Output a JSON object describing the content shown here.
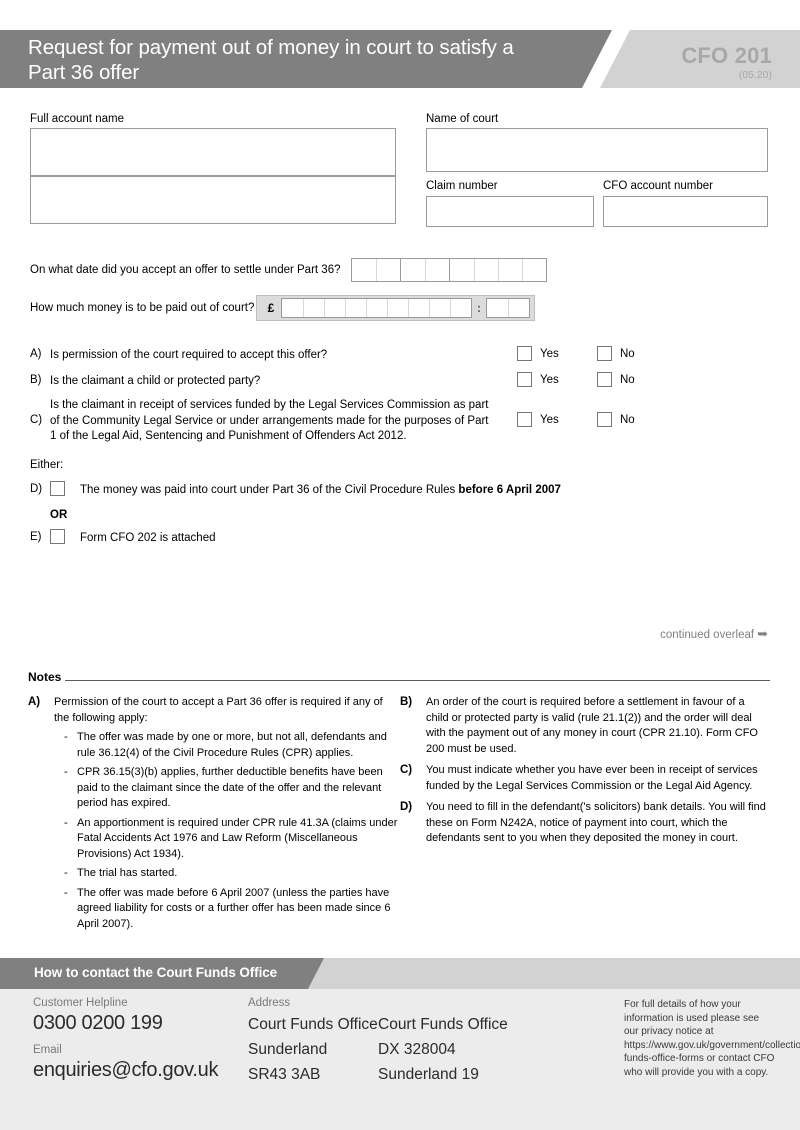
{
  "header": {
    "title": "Request for payment out of money in court to satisfy a Part 36 offer",
    "form_code": "CFO 201",
    "version": "(05.20)"
  },
  "fields": {
    "full_account_name_label": "Full account name",
    "name_of_court_label": "Name of court",
    "claim_number_label": "Claim number",
    "cfo_account_number_label": "CFO account number",
    "full_account_name_value": "",
    "full_account_name_value2": "",
    "name_of_court_value": "",
    "claim_number_value": "",
    "cfo_account_number_value": ""
  },
  "questions": {
    "date_label": "On what date did you accept an offer to settle under Part 36?",
    "money_label": "How much money is to be paid out of court?",
    "currency_symbol": "£",
    "decimal_separator": ":",
    "date_cells": [
      2,
      2,
      4
    ],
    "money_cells": 9,
    "pence_cells": 2,
    "yes_label": "Yes",
    "no_label": "No",
    "items": [
      {
        "letter": "A)",
        "text": "Is permission of the court required to accept this offer?"
      },
      {
        "letter": "B)",
        "text": "Is the claimant a child or protected party?"
      },
      {
        "letter": "C)",
        "text": "Is the claimant in receipt of services funded by the Legal Services Commission as part of the Community Legal Service or under arrangements made for the purposes of Part 1 of the Legal Aid, Sentencing and Punishment of Offenders Act 2012."
      }
    ]
  },
  "either": {
    "either_label": "Either:",
    "or_label": "OR",
    "option_d_letter": "D)",
    "option_d_text": "The money was paid into court under Part 36 of the Civil Procedure Rules ",
    "option_d_bold": "before 6 April 2007",
    "option_e_letter": "E)",
    "option_e_text": "Form CFO 202 is attached"
  },
  "continued": {
    "text": "continued overleaf",
    "arrow": "➥"
  },
  "notes": {
    "title": "Notes",
    "left": [
      {
        "letter": "A)",
        "body": "Permission of the court to accept a Part 36 offer is required if any of the following apply:",
        "subitems": [
          "The offer was made by one or more, but not all, defendants and rule 36.12(4) of the Civil Procedure Rules (CPR) applies.",
          "CPR 36.15(3)(b) applies, further deductible benefits have been paid to the claimant since the date of the offer and the relevant period has expired.",
          "An apportionment is required under CPR rule 41.3A (claims under Fatal Accidents Act 1976 and Law Reform (Miscellaneous Provisions) Act 1934).",
          "The trial has started.",
          "The offer was made before 6 April 2007 (unless the parties have agreed liability for costs or a further offer has been made since 6 April 2007)."
        ]
      }
    ],
    "right": [
      {
        "letter": "B)",
        "body": "An order of the court is required before a settlement in favour of a child or protected party is valid (rule 21.1(2)) and the order will deal with the payment out of any money in court (CPR 21.10). Form CFO 200 must be used."
      },
      {
        "letter": "C)",
        "body": "You must indicate whether you have ever been in receipt of services funded by the Legal Services Commission or the Legal Aid Agency."
      },
      {
        "letter": "D)",
        "body": "You need to fill in the defendant('s solicitors) bank details. You will find these on Form N242A, notice of payment into court, which the defendants sent to you when they deposited the money in court."
      }
    ]
  },
  "footer": {
    "band_title": "How to contact the Court Funds Office",
    "helpline_label": "Customer Helpline",
    "helpline_value": "0300 0200 199",
    "email_label": "Email",
    "email_value": "enquiries@cfo.gov.uk",
    "address_label": "Address",
    "address_col1": "Court Funds Office\nSunderland\nSR43 3AB",
    "address_col2": "Court Funds Office\nDX 328004\nSunderland 19",
    "privacy_text": "For full details of how your information is used please see our privacy notice at https://www.gov.uk/government/collections/court-funds-office-forms or contact CFO who will provide you with a copy."
  },
  "colors": {
    "banner_dark": "#808080",
    "banner_light": "#d2d2d2",
    "footer_bg": "#ececec",
    "field_border": "#9b9b9b",
    "muted_text": "#7a7a7a"
  }
}
